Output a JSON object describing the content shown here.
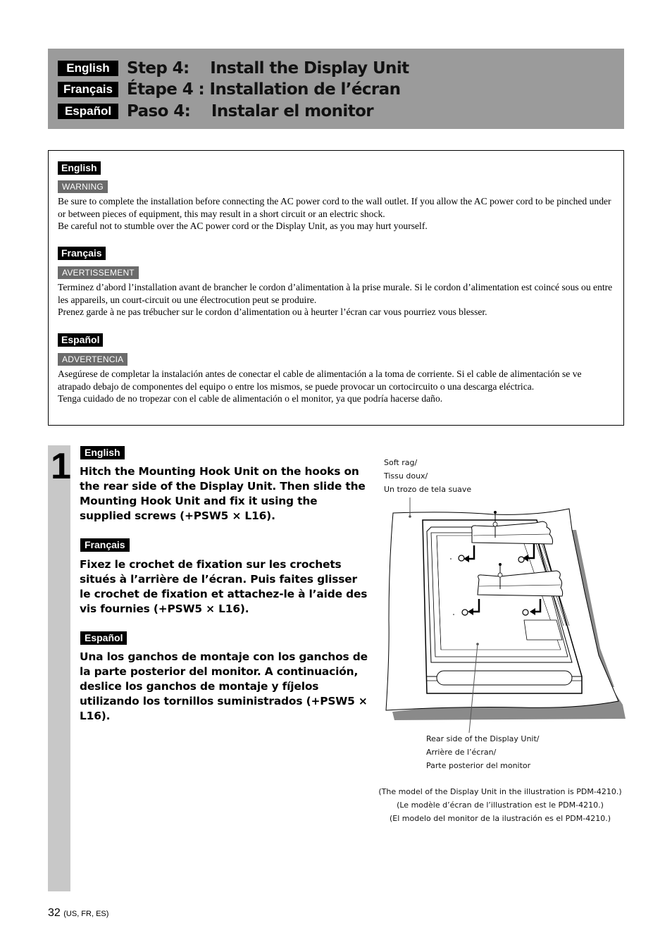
{
  "header": {
    "rows": [
      {
        "lang": "English",
        "title": "Step 4:    Install the Display Unit"
      },
      {
        "lang": "Français",
        "title": "Étape 4 : Installation de l’écran"
      },
      {
        "lang": "Español",
        "title": "Paso 4:    Instalar el monitor"
      }
    ]
  },
  "warnings": [
    {
      "lang": "English",
      "label": "WARNING",
      "paragraphs": [
        "Be sure to complete the installation before connecting the AC power cord to the wall outlet. If you allow the AC power cord to be pinched under or between pieces of equipment, this may result in a short circuit or an electric shock.",
        "Be careful not to stumble over the AC power cord or the Display Unit, as you may hurt yourself."
      ]
    },
    {
      "lang": "Français",
      "label": "AVERTISSEMENT",
      "paragraphs": [
        "Terminez d’abord l’installation avant de brancher le cordon d’alimentation à la prise murale. Si le cordon d’alimentation est coincé sous ou entre les appareils, un court-circuit ou une électrocution peut se produire.",
        "Prenez garde à ne pas trébucher sur le cordon d’alimentation ou à heurter l’écran car vous pourriez vous blesser."
      ]
    },
    {
      "lang": "Español",
      "label": "ADVERTENCIA",
      "paragraphs": [
        "Asegúrese de completar la instalación antes de conectar el cable de alimentación a la toma de corriente. Si el cable de alimentación se ve atrapado debajo de componentes del equipo o entre los mismos, se puede provocar un cortocircuito o una descarga eléctrica.",
        "Tenga cuidado de no tropezar con el cable de alimentación o el monitor, ya que podría hacerse daño."
      ]
    }
  ],
  "step": {
    "number": "1",
    "instructions": [
      {
        "lang": "English",
        "text": "Hitch the Mounting Hook Unit on the hooks on the rear side of the Display Unit. Then slide the Mounting Hook Unit and fix it using the supplied screws (+PSW5 × L16)."
      },
      {
        "lang": "Français",
        "text": "Fixez le crochet de fixation sur les crochets situés à l’arrière de l’écran. Puis faites glisser le crochet de fixation et attachez-le à l’aide des vis fournies (+PSW5 × L16)."
      },
      {
        "lang": "Español",
        "text": "Una los ganchos de montaje con los ganchos de la parte posterior del monitor. A continuación, deslice los ganchos de montaje y fíjelos utilizando los tornillos suministrados (+PSW5 × L16)."
      }
    ]
  },
  "illustration": {
    "label_soft_rag": [
      "Soft rag/",
      "Tissu doux/",
      "Un trozo de tela suave"
    ],
    "label_rear_side": [
      "Rear side of the Display Unit/",
      "Arrière de l’écran/",
      "Parte posterior del monitor"
    ],
    "model_note": [
      "(The model of the Display Unit in the illustration is PDM-4210.)",
      "(Le modèle d’écran de l’illustration est le PDM-4210.)",
      "(El modelo del monitor de la ilustración es el PDM-4210.)"
    ]
  },
  "footer": {
    "page_number": "32",
    "region": "(US, FR, ES)"
  },
  "colors": {
    "banner_bg": "#9b9b9b",
    "warning_tag_bg": "#6b6b6b",
    "step_bar_bg": "#c8c8c8"
  }
}
